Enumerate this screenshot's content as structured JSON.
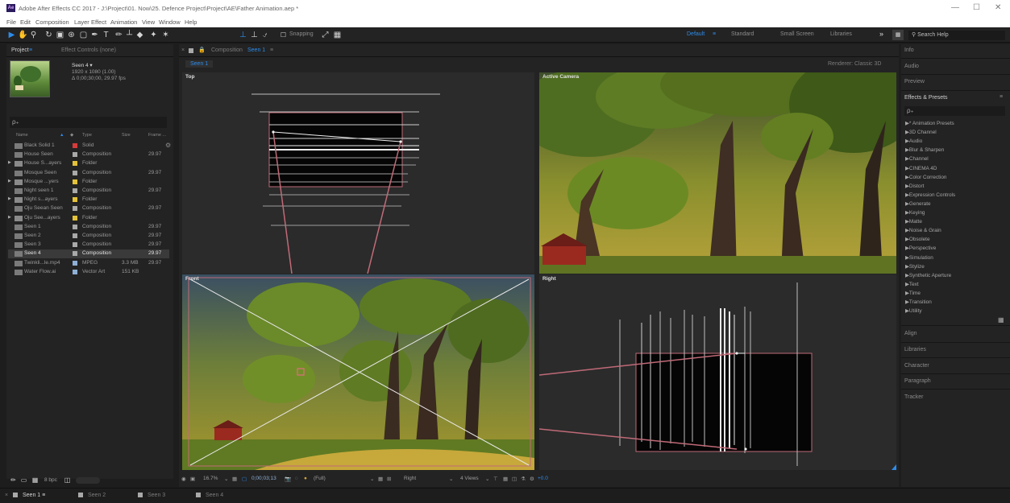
{
  "window": {
    "title": "Adobe After Effects CC 2017 - J:\\Project\\01. Now\\25. Defence Project\\Project\\AE\\Father Animation.aep *",
    "logo": "Ae",
    "min": "—",
    "max": "☐",
    "close": "✕"
  },
  "menu": [
    "File",
    "Edit",
    "Composition",
    "Layer",
    "Effect",
    "Animation",
    "View",
    "Window",
    "Help"
  ],
  "toolbar": {
    "snapping_label": "Snapping",
    "workspaces": [
      "Default",
      "Standard",
      "Small Screen",
      "Libraries"
    ],
    "more": "»",
    "search_help": "Search Help"
  },
  "project": {
    "tab_project": "Project",
    "tab_effect_controls": "Effect Controls (none)",
    "selected_comp_name": "Seen 4 ▾",
    "selected_comp_dims": "1920 x 1080 (1.00)",
    "selected_comp_duration": "Δ 0;00;30;00, 29.97 fps",
    "search_icon": "ρ₊",
    "columns": {
      "name": "Name",
      "type": "Type",
      "size": "Size",
      "frame": "Frame ..."
    },
    "items": [
      {
        "name": "Black Solid 1",
        "type": "Solid",
        "size": "",
        "frame": "",
        "color": "#d63b3b",
        "folder": false,
        "icon": "solid-icon",
        "selected": false
      },
      {
        "name": "House Seen",
        "type": "Composition",
        "size": "",
        "frame": "29.97",
        "color": "#a9a9a9",
        "folder": false,
        "icon": "composition-icon",
        "selected": false
      },
      {
        "name": "House S...ayers",
        "type": "Folder",
        "size": "",
        "frame": "",
        "color": "#e3c23a",
        "folder": true,
        "icon": "folder-icon",
        "selected": false
      },
      {
        "name": "Mosque Seen",
        "type": "Composition",
        "size": "",
        "frame": "29.97",
        "color": "#a9a9a9",
        "folder": false,
        "icon": "composition-icon",
        "selected": false
      },
      {
        "name": "Mosque ...yers",
        "type": "Folder",
        "size": "",
        "frame": "",
        "color": "#e3c23a",
        "folder": true,
        "icon": "folder-icon",
        "selected": false
      },
      {
        "name": "Night seen 1",
        "type": "Composition",
        "size": "",
        "frame": "29.97",
        "color": "#a9a9a9",
        "folder": false,
        "icon": "composition-icon",
        "selected": false
      },
      {
        "name": "Night s...ayers",
        "type": "Folder",
        "size": "",
        "frame": "",
        "color": "#e3c23a",
        "folder": true,
        "icon": "folder-icon",
        "selected": false
      },
      {
        "name": "Oju Seean Seen",
        "type": "Composition",
        "size": "",
        "frame": "29.97",
        "color": "#a9a9a9",
        "folder": false,
        "icon": "composition-icon",
        "selected": false
      },
      {
        "name": "Oju See...ayers",
        "type": "Folder",
        "size": "",
        "frame": "",
        "color": "#e3c23a",
        "folder": true,
        "icon": "folder-icon",
        "selected": false
      },
      {
        "name": "Seen 1",
        "type": "Composition",
        "size": "",
        "frame": "29.97",
        "color": "#a9a9a9",
        "folder": false,
        "icon": "composition-icon",
        "selected": false
      },
      {
        "name": "Seen 2",
        "type": "Composition",
        "size": "",
        "frame": "29.97",
        "color": "#a9a9a9",
        "folder": false,
        "icon": "composition-icon",
        "selected": false
      },
      {
        "name": "Seen 3",
        "type": "Composition",
        "size": "",
        "frame": "29.97",
        "color": "#a9a9a9",
        "folder": false,
        "icon": "composition-icon",
        "selected": false
      },
      {
        "name": "Seen 4",
        "type": "Composition",
        "size": "",
        "frame": "29.97",
        "color": "#a9a9a9",
        "folder": false,
        "icon": "composition-icon",
        "selected": true
      },
      {
        "name": "Twinkli...le.mp4",
        "type": "MPEG",
        "size": "3.3 MB",
        "frame": "29.97",
        "color": "#8fb0d6",
        "folder": false,
        "icon": "video-file-icon",
        "selected": false
      },
      {
        "name": "Water Flow.ai",
        "type": "Vector Art",
        "size": "151 KB",
        "frame": "",
        "color": "#8fb0d6",
        "folder": false,
        "icon": "vector-file-icon",
        "selected": false
      }
    ],
    "footer_bpc": "8 bpc"
  },
  "composition": {
    "tab_label": "Composition",
    "tab_name": "Seen 1",
    "sub_tab": "Seen 1",
    "renderer_label": "Renderer:",
    "renderer_value": "Classic 3D",
    "views": {
      "top": "Top",
      "camera": "Active Camera",
      "front": "Front",
      "right": "Right"
    },
    "footer": {
      "zoom": "16.7%",
      "timecode": "0;00;03;13",
      "resolution": "(Full)",
      "view": "Right",
      "layout": "4 Views",
      "exposure": "+0.0"
    }
  },
  "right_panels": {
    "info": "Info",
    "audio": "Audio",
    "preview": "Preview",
    "effects_presets": "Effects & Presets",
    "menu_icon": "≡",
    "effects": [
      "* Animation Presets",
      "3D Channel",
      "Audio",
      "Blur & Sharpen",
      "Channel",
      "CINEMA 4D",
      "Color Correction",
      "Distort",
      "Expression Controls",
      "Generate",
      "Keying",
      "Matte",
      "Noise & Grain",
      "Obsolete",
      "Perspective",
      "Simulation",
      "Stylize",
      "Synthetic Aperture",
      "Text",
      "Time",
      "Transition",
      "Utility"
    ],
    "align": "Align",
    "libraries": "Libraries",
    "character": "Character",
    "paragraph": "Paragraph",
    "tracker": "Tracker"
  },
  "timeline_tabs": [
    {
      "label": "Seen 1",
      "active": true
    },
    {
      "label": "Seen 2",
      "active": false
    },
    {
      "label": "Seen 3",
      "active": false
    },
    {
      "label": "Seen 4",
      "active": false
    }
  ],
  "colors": {
    "accent_blue": "#2d8ceb",
    "label_yellow": "#e3c23a",
    "label_red": "#d63b3b",
    "label_comp": "#a9a9a9"
  }
}
